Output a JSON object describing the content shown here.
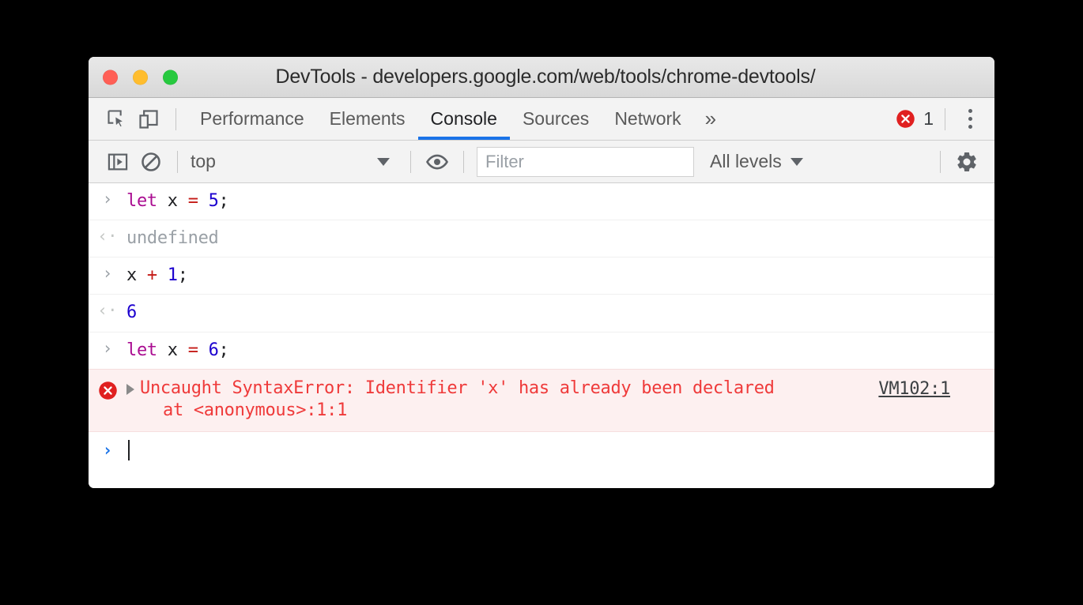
{
  "window": {
    "title": "DevTools - developers.google.com/web/tools/chrome-devtools/",
    "traffic_lights": [
      "close",
      "minimize",
      "maximize"
    ]
  },
  "tabbar": {
    "left_icons": [
      {
        "name": "inspect-element-icon",
        "label": "Inspect element"
      },
      {
        "name": "device-toolbar-icon",
        "label": "Toggle device toolbar"
      }
    ],
    "tabs": [
      {
        "label": "Performance",
        "active": false
      },
      {
        "label": "Elements",
        "active": false
      },
      {
        "label": "Console",
        "active": true
      },
      {
        "label": "Sources",
        "active": false
      },
      {
        "label": "Network",
        "active": false
      }
    ],
    "overflow_label": "»",
    "error_count": "1",
    "menu_label": "Customize and control DevTools"
  },
  "console_toolbar": {
    "sidebar_toggle_label": "Show console sidebar",
    "clear_label": "Clear console",
    "context": "top",
    "live_expression_label": "Create live expression",
    "filter_placeholder": "Filter",
    "filter_value": "",
    "levels": "All levels",
    "settings_label": "Console settings"
  },
  "console": {
    "entries": [
      {
        "type": "input",
        "gutter": "›",
        "tokens": [
          {
            "text": "let",
            "cls": "kw2"
          },
          {
            "text": " x ",
            "cls": "plain"
          },
          {
            "text": "=",
            "cls": "op"
          },
          {
            "text": " ",
            "cls": "plain"
          },
          {
            "text": "5",
            "cls": "num"
          },
          {
            "text": ";",
            "cls": "plain"
          }
        ],
        "plain_text": "let x = 5;"
      },
      {
        "type": "output",
        "gutter": "‹·",
        "tokens": [
          {
            "text": "undefined",
            "cls": "muted"
          }
        ],
        "plain_text": "undefined"
      },
      {
        "type": "input",
        "gutter": "›",
        "tokens": [
          {
            "text": "x ",
            "cls": "plain"
          },
          {
            "text": "+",
            "cls": "op"
          },
          {
            "text": " ",
            "cls": "plain"
          },
          {
            "text": "1",
            "cls": "num"
          },
          {
            "text": ";",
            "cls": "plain"
          }
        ],
        "plain_text": "x + 1;"
      },
      {
        "type": "output",
        "gutter": "‹·",
        "tokens": [
          {
            "text": "6",
            "cls": "num"
          }
        ],
        "plain_text": "6"
      },
      {
        "type": "input",
        "gutter": "›",
        "tokens": [
          {
            "text": "let",
            "cls": "kw2"
          },
          {
            "text": " x ",
            "cls": "plain"
          },
          {
            "text": "=",
            "cls": "op"
          },
          {
            "text": " ",
            "cls": "plain"
          },
          {
            "text": "6",
            "cls": "num"
          },
          {
            "text": ";",
            "cls": "plain"
          }
        ],
        "plain_text": "let x = 6;"
      }
    ],
    "error": {
      "line1": "Uncaught SyntaxError: Identifier 'x' has already been declared",
      "line2": "at <anonymous>:1:1",
      "source_link": "VM102:1"
    },
    "prompt": {
      "gutter": "›",
      "value": ""
    }
  },
  "colors": {
    "accent": "#1a73e8",
    "error_red": "#ef3a3a",
    "error_bg": "#fdf0f0",
    "error_icon": "#e02020",
    "keyword": "#aa0d91",
    "number": "#1c00cf",
    "operator": "#c41a16",
    "muted": "#9aa0a6",
    "toolbar_bg": "#f3f3f3",
    "titlebar_bg": "#e0e0e0"
  }
}
